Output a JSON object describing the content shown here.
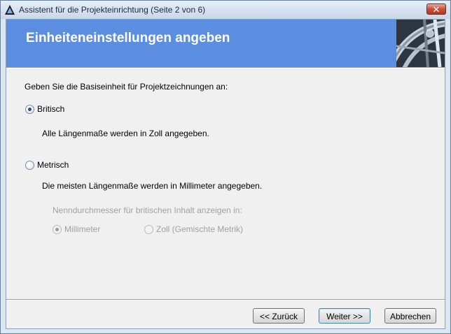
{
  "window": {
    "title": "Assistent für die Projekteinrichtung (Seite 2 von 6)"
  },
  "banner": {
    "title": "Einheiteneinstellungen angeben"
  },
  "content": {
    "prompt": "Geben Sie die Basiseinheit für Projektzeichnungen an:",
    "british": {
      "label": "Britisch",
      "description": "Alle Längenmaße werden in Zoll angegeben.",
      "selected": true
    },
    "metric": {
      "label": "Metrisch",
      "description": "Die meisten Längenmaße werden in Millimeter angegeben.",
      "selected": false
    },
    "nominal": {
      "label": "Nenndurchmesser für britischen Inhalt anzeigen in:",
      "options": [
        {
          "label": "Millimeter",
          "selected": true,
          "enabled": false
        },
        {
          "label": "Zoll (Gemischte Metrik)",
          "selected": false,
          "enabled": false
        }
      ]
    }
  },
  "buttons": {
    "back": "<< Zurück",
    "next": "Weiter >>",
    "cancel": "Abbrechen"
  },
  "icons": {
    "app": "autocad-logo-icon",
    "close": "close-icon"
  }
}
